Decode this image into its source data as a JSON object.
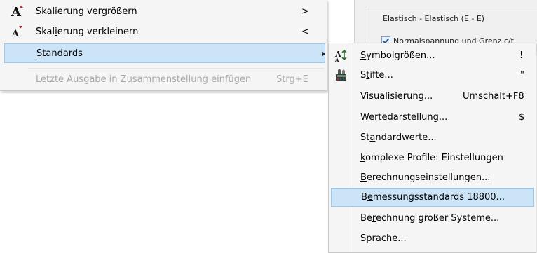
{
  "background_panel": {
    "group_title": "Elastisch - Elastisch (E - E)",
    "checkbox_label": "Normalspannung und Grenz c/t",
    "checkbox_checked": true
  },
  "main_menu": {
    "items": [
      {
        "label": "Skalierung vergrößern",
        "mnemonic_index": 2,
        "shortcut": ">",
        "icon": "scale-up-icon",
        "state": "normal"
      },
      {
        "label": "Skalierung verkleinern",
        "mnemonic_index": 4,
        "shortcut": "<",
        "icon": "scale-down-icon",
        "state": "normal"
      },
      {
        "label": "Standards",
        "mnemonic_index": 0,
        "shortcut": "",
        "icon": "",
        "state": "selected",
        "has_submenu": true
      },
      {
        "label": "Letzte Ausgabe in Zusammenstellung einfügen",
        "mnemonic_index": 2,
        "shortcut": "Strg+E",
        "icon": "",
        "state": "disabled"
      }
    ]
  },
  "sub_menu": {
    "items": [
      {
        "label": "Symbolgrößen...",
        "mnemonic_index": 0,
        "shortcut": "!",
        "icon": "symbol-size-icon",
        "state": "normal"
      },
      {
        "label": "Stifte...",
        "mnemonic_index": 1,
        "shortcut": "\"",
        "icon": "pens-icon",
        "state": "normal"
      },
      {
        "label": "Visualisierung...",
        "mnemonic_index": 0,
        "shortcut": "Umschalt+F8",
        "icon": "",
        "state": "normal"
      },
      {
        "label": "Wertedarstellung...",
        "mnemonic_index": 0,
        "shortcut": "$",
        "icon": "",
        "state": "normal"
      },
      {
        "label": "Standardwerte...",
        "mnemonic_index": 2,
        "shortcut": "",
        "icon": "",
        "state": "normal"
      },
      {
        "label": "komplexe Profile: Einstellungen",
        "mnemonic_index": 0,
        "shortcut": "",
        "icon": "",
        "state": "normal"
      },
      {
        "label": "Berechnungseinstellungen...",
        "mnemonic_index": 0,
        "shortcut": "",
        "icon": "",
        "state": "normal"
      },
      {
        "label": "Bemessungsstandards 18800...",
        "mnemonic_index": 1,
        "shortcut": "",
        "icon": "",
        "state": "selected"
      },
      {
        "label": "Berechnung großer Systeme...",
        "mnemonic_index": 2,
        "shortcut": "",
        "icon": "",
        "state": "normal"
      },
      {
        "label": "Sprache...",
        "mnemonic_index": 1,
        "shortcut": "",
        "icon": "",
        "state": "normal"
      }
    ]
  },
  "colors": {
    "menu_bg": "#f5f5f5",
    "highlight_bg": "#cce4f7",
    "highlight_border": "#99c9ef",
    "disabled_text": "#a8a8a8",
    "icon_red": "#c0242a"
  }
}
